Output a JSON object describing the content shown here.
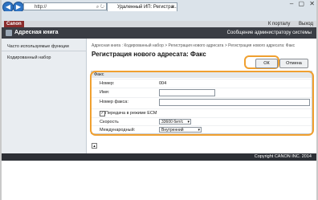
{
  "browser": {
    "address": "http://",
    "tab_title": "Удаленный ИП: Регистра..."
  },
  "app": {
    "brand": "Canon",
    "top_links": [
      "К порталу",
      "Выход"
    ],
    "section_title": "Адресная книга",
    "admin_message": "Сообщение администратору системы"
  },
  "sidebar": {
    "items": [
      {
        "label": "Часто используемые функции"
      },
      {
        "label": "Кодированный набор"
      }
    ]
  },
  "main": {
    "breadcrumb": "Адресная книга : Кодированный набор > Регистрация нового адресата > Регистрация нового адресата: Факс",
    "page_title": "Регистрация нового адресата: Факс",
    "ok_label": "ОК",
    "cancel_label": "Отмена"
  },
  "form": {
    "section_label": "Факс",
    "number_label": "Номер:",
    "number_value": "004",
    "name_label": "Имя:",
    "name_value": "",
    "fax_label": "Номер факса:",
    "fax_value": "",
    "ecm_label": "Передача в режиме ECM",
    "ecm_checked": true,
    "speed_label": "Скорость",
    "speed_value": "33600 бит/с",
    "intl_label": "Международный:",
    "intl_value": "Внутренний"
  },
  "footer": {
    "copyright": "Copyright CANON INC. 2014"
  }
}
